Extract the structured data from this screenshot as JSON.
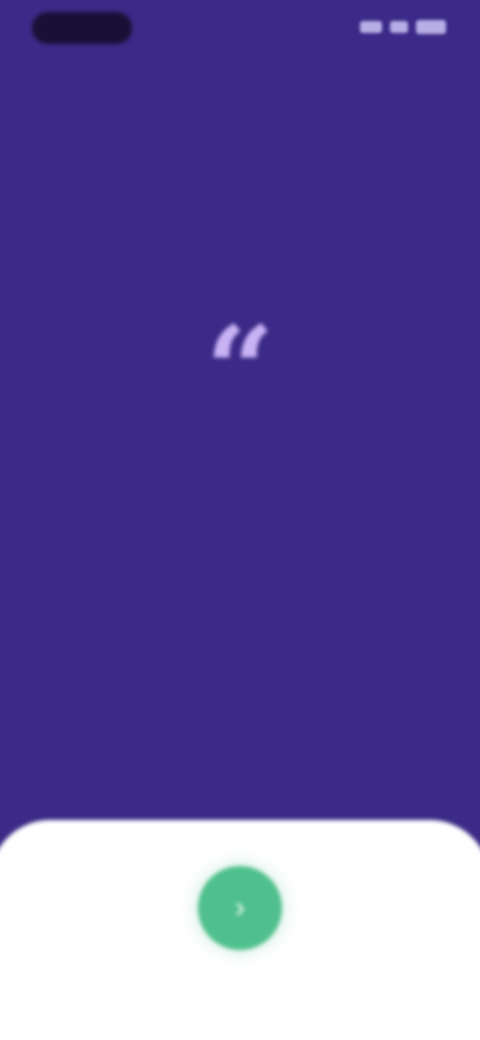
{
  "status_bar": {
    "time": "",
    "icons": [
      "signal-icon",
      "wifi-icon",
      "battery-icon"
    ]
  },
  "quote": {
    "mark": "“",
    "text": "",
    "author": ""
  },
  "action": {
    "icon": "chevron-right-icon",
    "glyph": "›",
    "label": ""
  },
  "colors": {
    "background": "#3B2A87",
    "quote_mark": "#C9B3F5",
    "sheet": "#FFFFFF",
    "accent": "#4FC08D"
  }
}
